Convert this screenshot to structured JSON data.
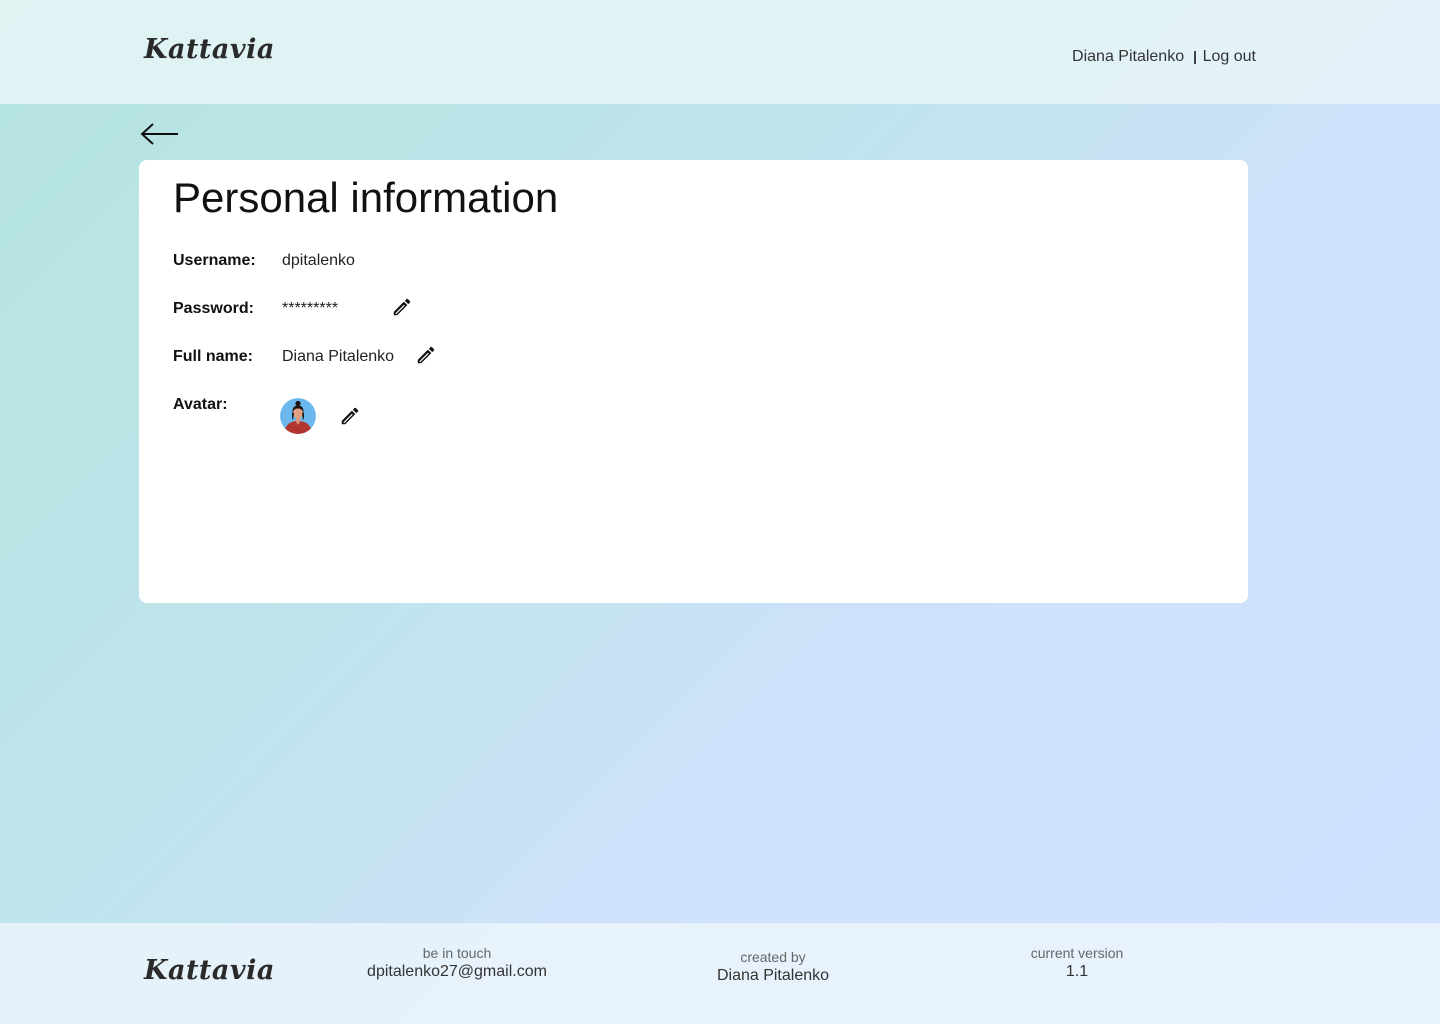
{
  "header": {
    "logo": "Kattavia",
    "user_name": "Diana Pitalenko",
    "logout_label": "Log out"
  },
  "profile": {
    "title": "Personal information",
    "username": {
      "label": "Username:",
      "value": "dpitalenko"
    },
    "password": {
      "label": "Password:",
      "value": "*********"
    },
    "full_name": {
      "label": "Full name:",
      "value": "Diana Pitalenko"
    },
    "avatar": {
      "label": "Avatar:"
    }
  },
  "footer": {
    "logo": "Kattavia",
    "contact_caption": "be in touch",
    "contact_email": "dpitalenko27@gmail.com",
    "creator_caption": "created by",
    "creator_name": "Diana Pitalenko",
    "version_caption": "current version",
    "version_value": "1.1"
  },
  "icons": {
    "back": "arrow-left-icon",
    "edit": "pencil-icon"
  },
  "colors": {
    "avatar_background": "#6ab8ee",
    "avatar_shirt": "#b0362f",
    "card_background": "#ffffff"
  }
}
